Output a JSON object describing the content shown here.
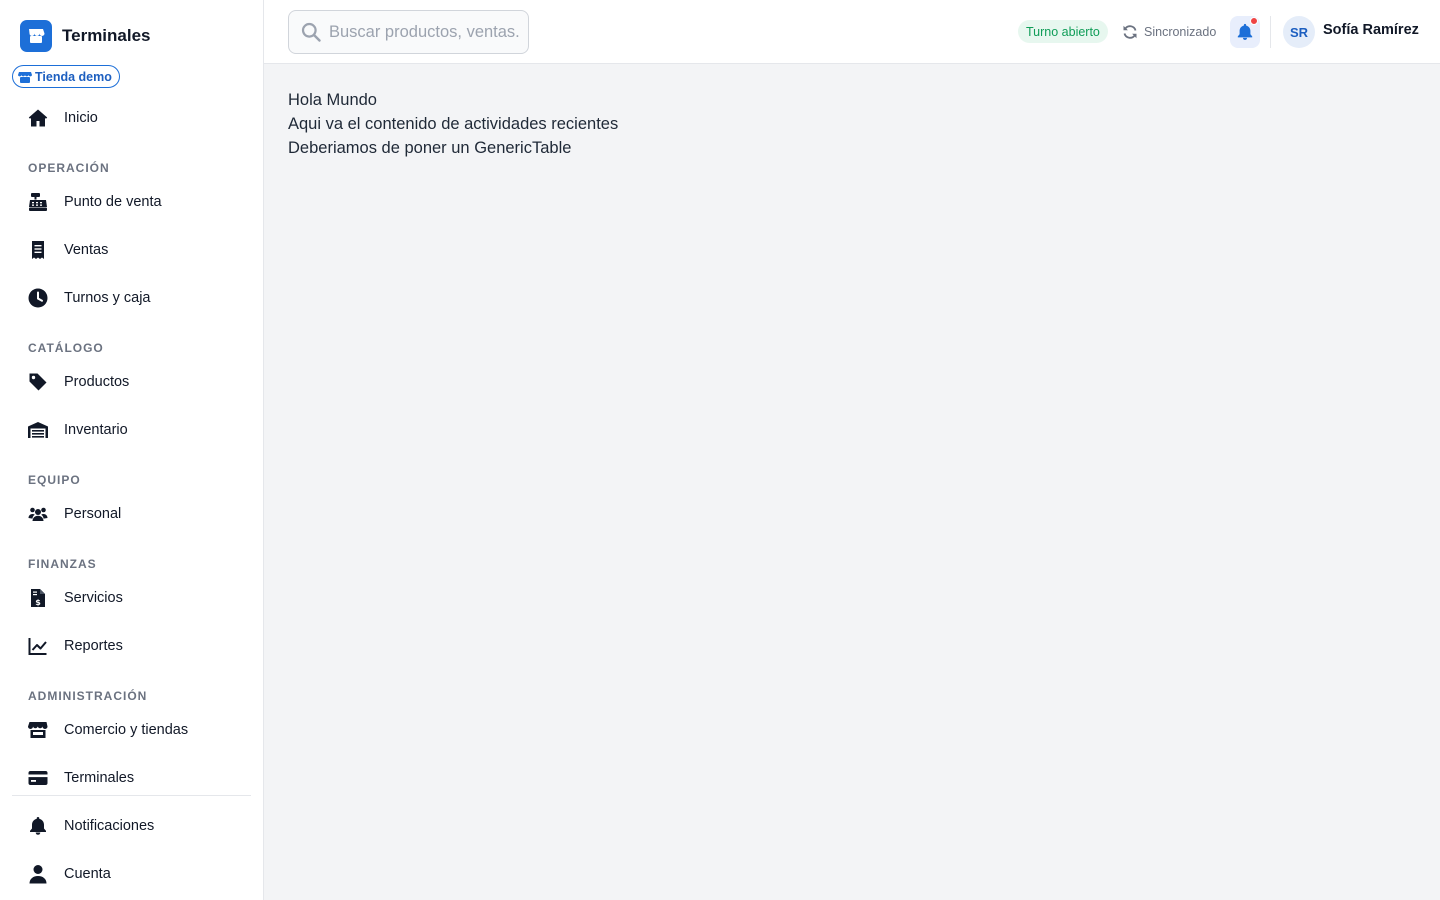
{
  "brand": {
    "name": "Terminales",
    "store": "Tienda demo"
  },
  "sidebar": {
    "home": {
      "label": "Inicio",
      "icon": "home-icon"
    },
    "sections": [
      {
        "title": "OPERACIÓN",
        "items": [
          {
            "label": "Punto de venta",
            "icon": "cash-register-icon"
          },
          {
            "label": "Ventas",
            "icon": "receipt-icon"
          },
          {
            "label": "Turnos y caja",
            "icon": "clock-icon"
          }
        ]
      },
      {
        "title": "CATÁLOGO",
        "items": [
          {
            "label": "Productos",
            "icon": "tag-icon"
          },
          {
            "label": "Inventario",
            "icon": "warehouse-icon"
          }
        ]
      },
      {
        "title": "EQUIPO",
        "items": [
          {
            "label": "Personal",
            "icon": "users-icon"
          }
        ]
      },
      {
        "title": "FINANZAS",
        "items": [
          {
            "label": "Servicios",
            "icon": "invoice-dollar-icon"
          },
          {
            "label": "Reportes",
            "icon": "chart-line-icon"
          }
        ]
      },
      {
        "title": "ADMINISTRACIÓN",
        "items": [
          {
            "label": "Comercio y tiendas",
            "icon": "store-icon"
          },
          {
            "label": "Terminales",
            "icon": "credit-card-icon"
          }
        ]
      }
    ],
    "footer": [
      {
        "label": "Notificaciones",
        "icon": "bell-icon"
      },
      {
        "label": "Cuenta",
        "icon": "user-icon"
      }
    ]
  },
  "header": {
    "search_placeholder": "Buscar productos, ventas...",
    "shift_status": "Turno abierto",
    "sync_status": "Sincronizado",
    "user_initials": "SR",
    "user_name": "Sofía Ramírez"
  },
  "main": {
    "lines": [
      "Hola Mundo",
      "Aqui va el contenido de actividades recientes",
      "Deberiamos de poner un GenericTable"
    ]
  },
  "colors": {
    "accent": "#1d6fd8",
    "success": "#0f9d58",
    "notification_dot": "#ef4444",
    "background": "#f3f4f6"
  }
}
